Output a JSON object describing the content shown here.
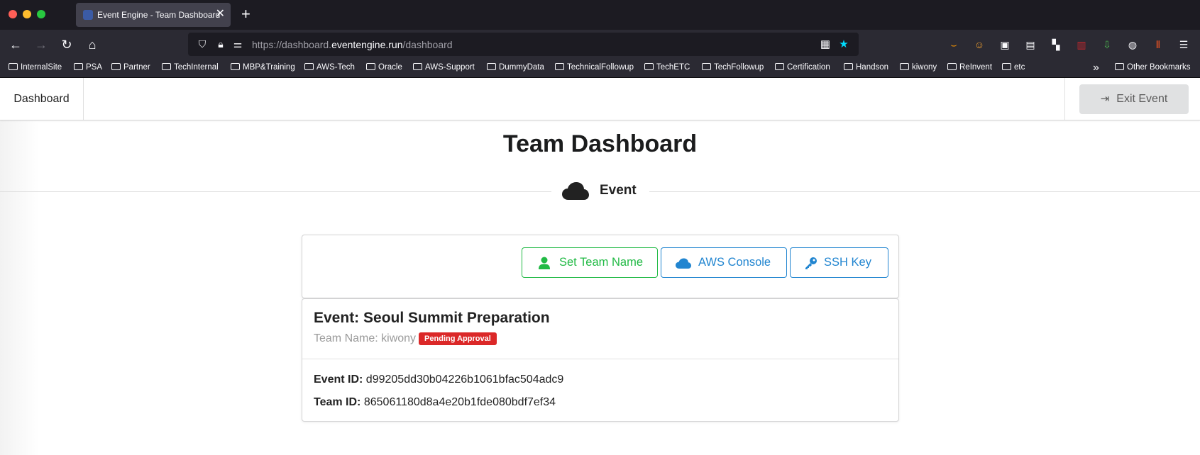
{
  "browser": {
    "tab_title": "Event Engine - Team Dashboard",
    "tab_close": "✕",
    "new_tab": "+",
    "url_host_prefix": "https://dashboard.",
    "url_host_main": "eventengine.run",
    "url_path": "/dashboard",
    "bookmarks": [
      "InternalSite",
      "PSA",
      "Partner",
      "TechInternal",
      "MBP&Training",
      "AWS-Tech",
      "Oracle",
      "AWS-Support",
      "DummyData",
      "TechnicalFollowup",
      "TechETC",
      "TechFollowup",
      "Certification",
      "Handson",
      "kiwony",
      "ReInvent",
      "etc"
    ],
    "other_bookmarks": "Other Bookmarks"
  },
  "menu": {
    "dashboard": "Dashboard",
    "exit_event": "Exit Event"
  },
  "page": {
    "title": "Team Dashboard",
    "section_label": "Event"
  },
  "actions": {
    "set_team_name": "Set Team Name",
    "aws_console": "AWS Console",
    "ssh_key": "SSH Key"
  },
  "info": {
    "event_label": "Event: Seoul Summit Preparation",
    "team_name_label": "Team Name: kiwony",
    "status_badge": "Pending Approval",
    "event_id_label": "Event ID:",
    "event_id_value": "d99205dd30b04226b1061bfac504adc9",
    "team_id_label": "Team ID:",
    "team_id_value": "865061180d8a4e20b1fde080bdf7ef34"
  },
  "colors": {
    "green": "#21ba45",
    "blue": "#2185d0",
    "red": "#db2828"
  }
}
